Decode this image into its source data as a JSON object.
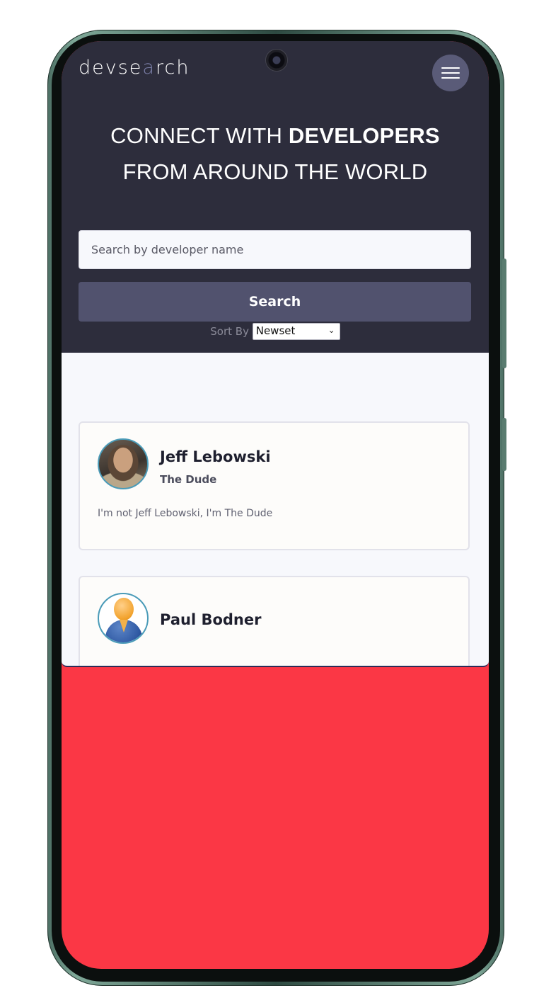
{
  "app": {
    "logo_text_prefix": "devse",
    "logo_text_accent": "a",
    "logo_text_suffix": "rch"
  },
  "header": {
    "menu_icon": "hamburger-menu-icon",
    "hero_line1_prefix": "CONNECT WITH ",
    "hero_line1_bold": "DEVELOPERS",
    "hero_line2": "FROM AROUND THE WORLD"
  },
  "search": {
    "placeholder": "Search by developer name",
    "value": "",
    "button_label": "Search"
  },
  "sort": {
    "label": "Sort By",
    "selected": "Newset"
  },
  "developers": [
    {
      "name": "Jeff Lebowski",
      "tagline": "The Dude",
      "bio": "I'm not Jeff Lebowski, I'm The Dude",
      "avatar": "profile-photo"
    },
    {
      "name": "Paul Bodner",
      "tagline": "",
      "bio": "",
      "avatar": "default-user-avatar-icon"
    }
  ],
  "colors": {
    "header_bg": "#2d2d3c",
    "button_bg": "#51526e",
    "content_bg": "#f7f8fc",
    "card_bg": "#fdfcfa",
    "avatar_border": "#4a9bb8",
    "bottom_fill": "#fb3745"
  }
}
